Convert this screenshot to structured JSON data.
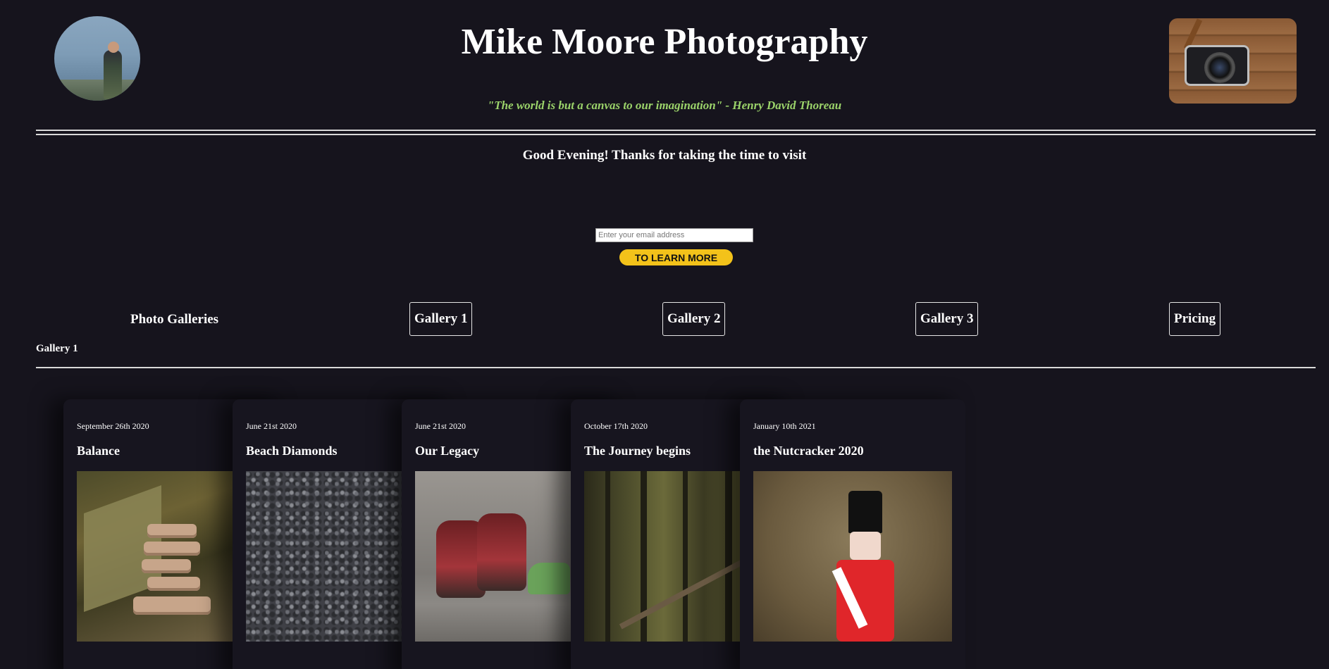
{
  "header": {
    "title": "Mike Moore Photography",
    "quote": "\"The world is but a canvas to our imagination\" - Henry David Thoreau",
    "avatar_icon": "photographer-avatar",
    "camera_icon": "camera-photo"
  },
  "greeting": "Good Evening! Thanks for taking the time to visit",
  "signup": {
    "email_placeholder": "Enter your email address",
    "email_value": "",
    "button_label": "TO LEARN MORE",
    "button_color": "#f3c21a"
  },
  "nav": {
    "heading": "Photo Galleries",
    "items": [
      {
        "label": "Gallery 1"
      },
      {
        "label": "Gallery 2"
      },
      {
        "label": "Gallery 3"
      },
      {
        "label": "Pricing"
      }
    ]
  },
  "section": {
    "label": "Gallery 1"
  },
  "cards": [
    {
      "date": "September 26th 2020",
      "title": "Balance"
    },
    {
      "date": "June 21st 2020",
      "title": "Beach Diamonds"
    },
    {
      "date": "June 21st 2020",
      "title": "Our Legacy"
    },
    {
      "date": "October 17th 2020",
      "title": "The Journey begins"
    },
    {
      "date": "January 10th 2021",
      "title": "the Nutcracker 2020"
    }
  ],
  "colors": {
    "background": "#16141d",
    "quote": "#9bd36a",
    "accent": "#f3c21a"
  }
}
